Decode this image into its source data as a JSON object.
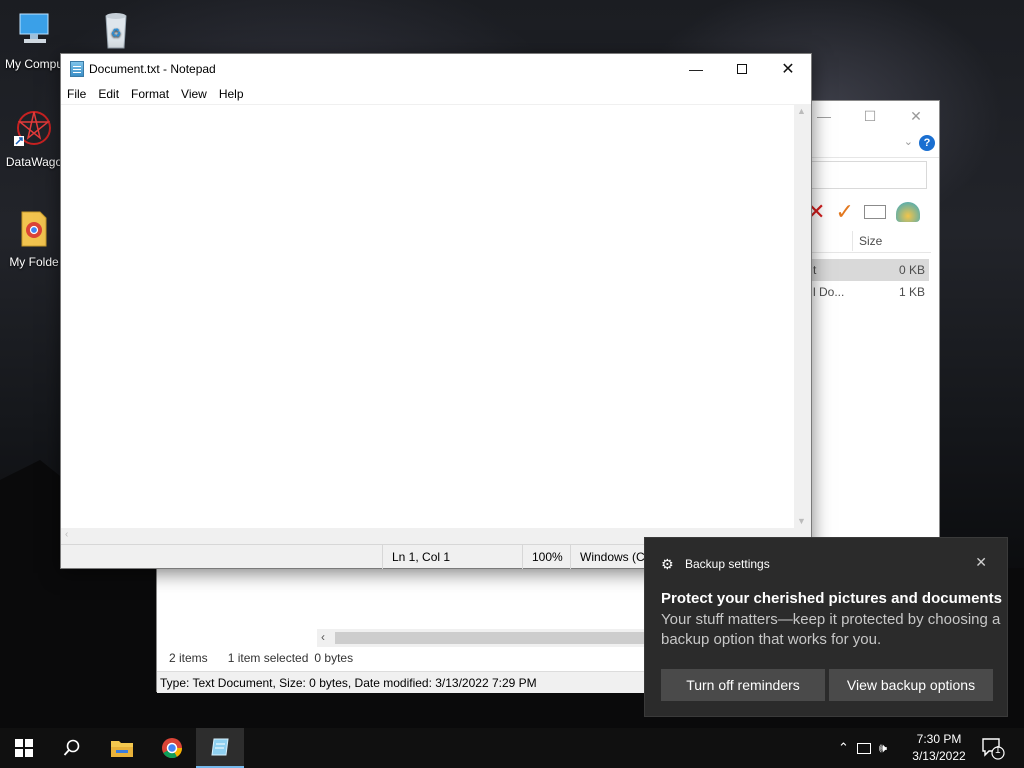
{
  "desktop": {
    "icons": [
      {
        "label": "My Compu"
      },
      {
        "label": ""
      },
      {
        "label": "DataWago"
      },
      {
        "label": "My Folde"
      }
    ]
  },
  "explorer": {
    "columns": {
      "size": "Size"
    },
    "rows": [
      {
        "name": "t",
        "size": "0 KB",
        "selected": true
      },
      {
        "name": "l Do...",
        "size": "1 KB",
        "selected": false
      }
    ],
    "status": {
      "items": "2 items",
      "selected": "1 item selected",
      "bytes": "0 bytes"
    },
    "details": "Type: Text Document, Size: 0 bytes, Date modified: 3/13/2022 7:29 PM"
  },
  "notepad": {
    "title": "Document.txt - Notepad",
    "menu": [
      "File",
      "Edit",
      "Format",
      "View",
      "Help"
    ],
    "content": "",
    "status": {
      "position": "Ln 1, Col 1",
      "zoom": "100%",
      "encoding": "Windows (C"
    }
  },
  "toast": {
    "app": "Backup settings",
    "heading": "Protect your cherished pictures and documents",
    "body": "Your stuff matters—keep it protected by choosing a backup option that works for you.",
    "button_off": "Turn off reminders",
    "button_view": "View backup options"
  },
  "taskbar": {
    "time": "7:30 PM",
    "date": "3/13/2022",
    "notification_count": "1"
  },
  "colors": {
    "accent": "#76b9ed",
    "toast_bg": "#2b2b2b",
    "help_blue": "#1a6fd1",
    "delete_red": "#d21c1c",
    "check_orange": "#e2781f"
  }
}
